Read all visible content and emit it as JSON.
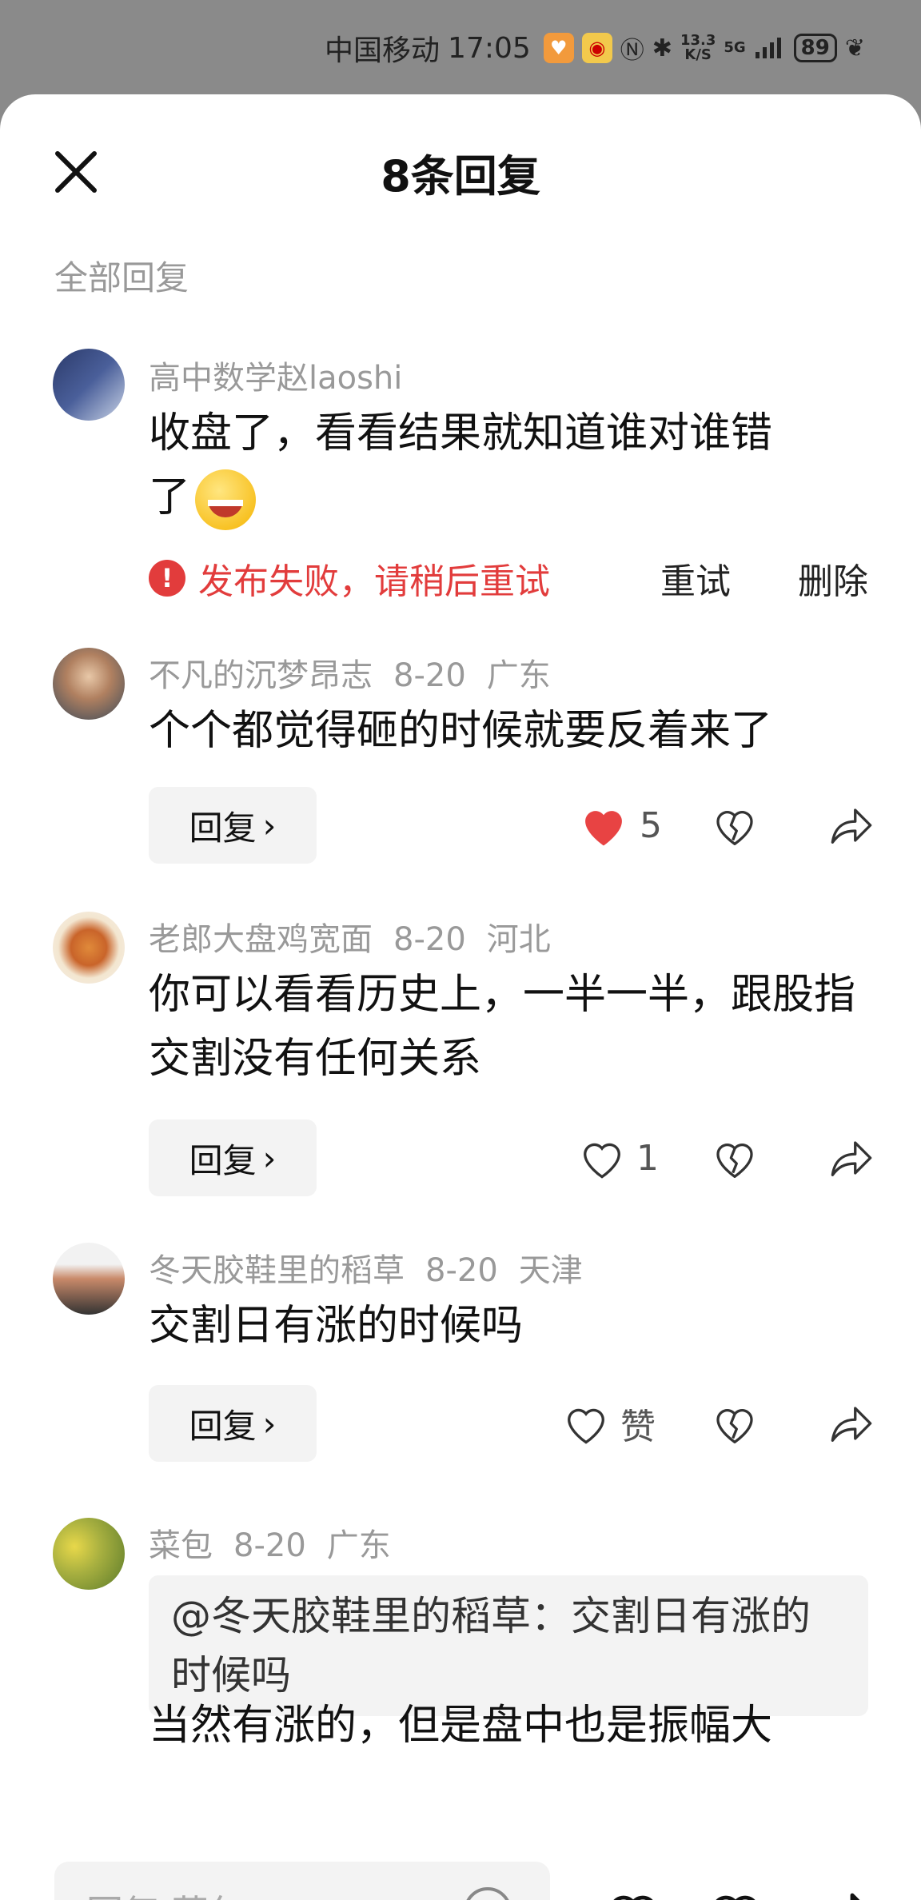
{
  "status_bar": {
    "carrier": "中国移动",
    "time": "17:05",
    "net_speed_top": "13.3",
    "net_speed_unit": "K/S",
    "network": "5G",
    "battery": "89"
  },
  "header": {
    "title": "8条回复"
  },
  "section_label": "全部回复",
  "comments": [
    {
      "username": "高中数学赵laoshi",
      "text_line1": "收盘了，看看结果就知道谁对谁错",
      "text_line2": "了",
      "fail_text": "发布失败，请稍后重试",
      "retry_label": "重试",
      "delete_label": "删除"
    },
    {
      "username": "不凡的沉梦昂志",
      "date": "8-20",
      "location": "广东",
      "text": "个个都觉得砸的时候就要反着来了",
      "reply_label": "回复",
      "like_count": "5"
    },
    {
      "username": "老郎大盘鸡宽面",
      "date": "8-20",
      "location": "河北",
      "text": "你可以看看历史上，一半一半，跟股指交割没有任何关系",
      "reply_label": "回复",
      "like_count": "1"
    },
    {
      "username": "冬天胶鞋里的稻草",
      "date": "8-20",
      "location": "天津",
      "text": "交割日有涨的时候吗",
      "reply_label": "回复",
      "like_count": "赞"
    },
    {
      "username": "菜包",
      "date": "8-20",
      "location": "广东",
      "quote": "@冬天胶鞋里的稻草：交割日有涨的时候吗",
      "text_partial": "当然有涨的，但是盘中也是振幅大"
    }
  ],
  "bottom_bar": {
    "input_placeholder": "回复 菜包："
  },
  "colors": {
    "accent_red": "#e23c3c",
    "like_red": "#e84343",
    "muted": "#999999"
  }
}
